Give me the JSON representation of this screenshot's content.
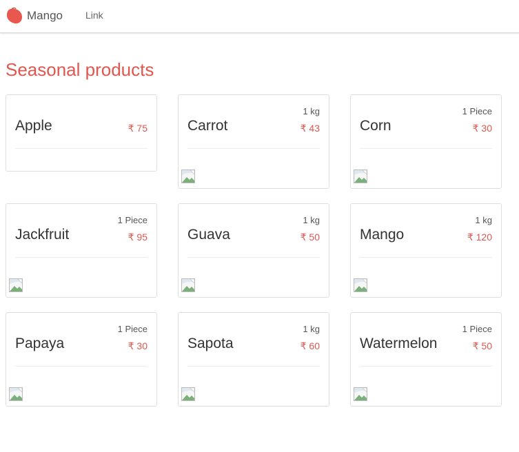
{
  "nav": {
    "brand": "Mango",
    "brand_icon": "mango-logo-icon",
    "brand_color": "#e8584f",
    "links": [
      "Link"
    ]
  },
  "main": {
    "title": "Seasonal products",
    "title_color": "#e0574f",
    "products": [
      {
        "name": "Apple",
        "unit": "",
        "price": "₹ 75",
        "has_image": false
      },
      {
        "name": "Carrot",
        "unit": "1 kg",
        "price": "₹ 43",
        "has_image": true
      },
      {
        "name": "Corn",
        "unit": "1 Piece",
        "price": "₹ 30",
        "has_image": true
      },
      {
        "name": "Jackfruit",
        "unit": "1 Piece",
        "price": "₹ 95",
        "has_image": true
      },
      {
        "name": "Guava",
        "unit": "1 kg",
        "price": "₹ 50",
        "has_image": true
      },
      {
        "name": "Mango",
        "unit": "1 kg",
        "price": "₹ 120",
        "has_image": true
      },
      {
        "name": "Papaya",
        "unit": "1 Piece",
        "price": "₹ 30",
        "has_image": true
      },
      {
        "name": "Sapota",
        "unit": "1 kg",
        "price": "₹ 60",
        "has_image": true
      },
      {
        "name": "Watermelon",
        "unit": "1 Piece",
        "price": "₹ 50",
        "has_image": true
      }
    ]
  }
}
